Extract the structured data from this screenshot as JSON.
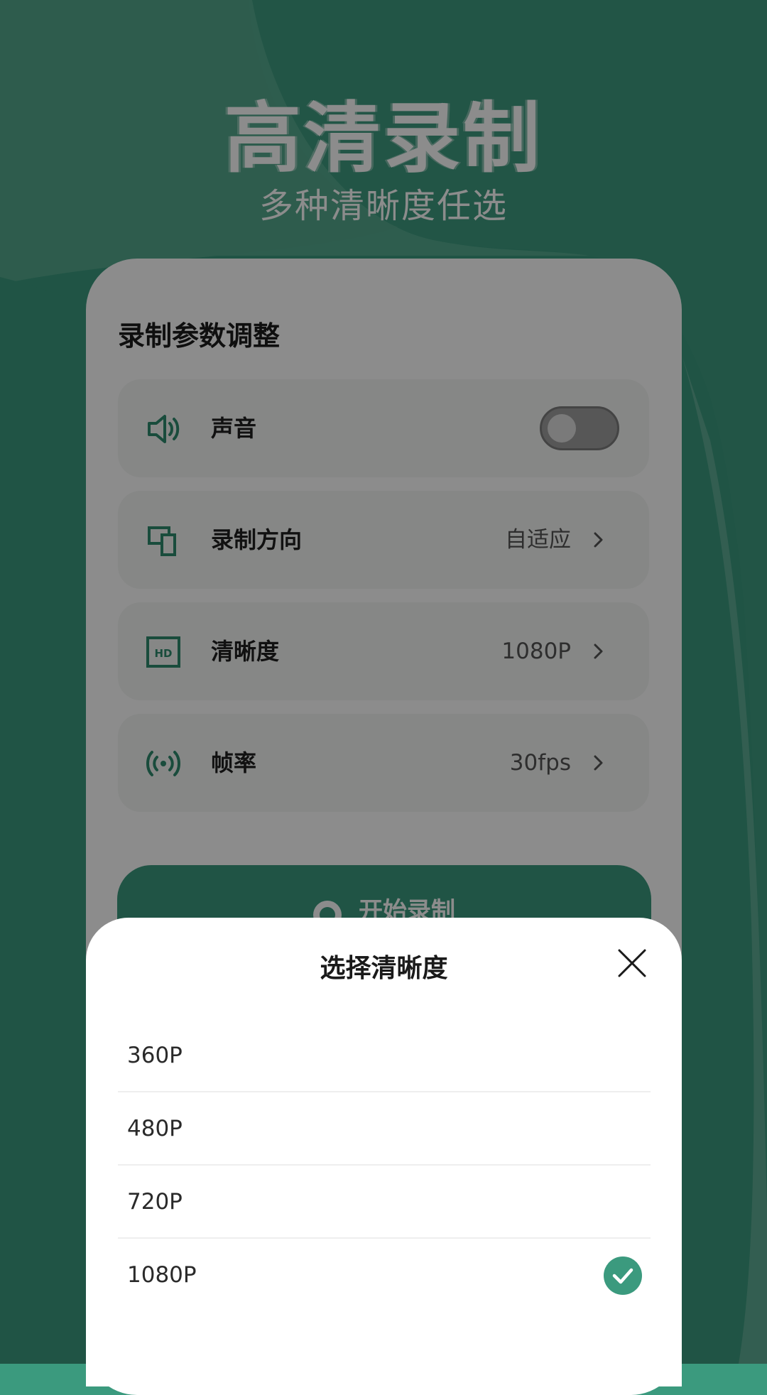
{
  "hero": {
    "title": "高清录制",
    "subtitle": "多种清晰度任选"
  },
  "colors": {
    "brand_green": "#3b9a7e",
    "light_green": "#5aa990",
    "white": "#ffffff"
  },
  "settings": {
    "title": "录制参数调整",
    "rows": [
      {
        "label": "声音",
        "icon": "speaker-icon",
        "control": "toggle",
        "toggle_on": false
      },
      {
        "label": "录制方向",
        "icon": "orientation-icon",
        "value": "自适应"
      },
      {
        "label": "清晰度",
        "icon": "hd-icon",
        "value": "1080P"
      },
      {
        "label": "帧率",
        "icon": "signal-icon",
        "value": "30fps"
      }
    ],
    "start_button": {
      "label": "开始录制",
      "icon": "record-icon"
    }
  },
  "sheet": {
    "title": "选择清晰度",
    "close_icon": "close-icon",
    "options": [
      {
        "label": "360P",
        "selected": false
      },
      {
        "label": "480P",
        "selected": false
      },
      {
        "label": "720P",
        "selected": false
      },
      {
        "label": "1080P",
        "selected": true
      }
    ]
  }
}
